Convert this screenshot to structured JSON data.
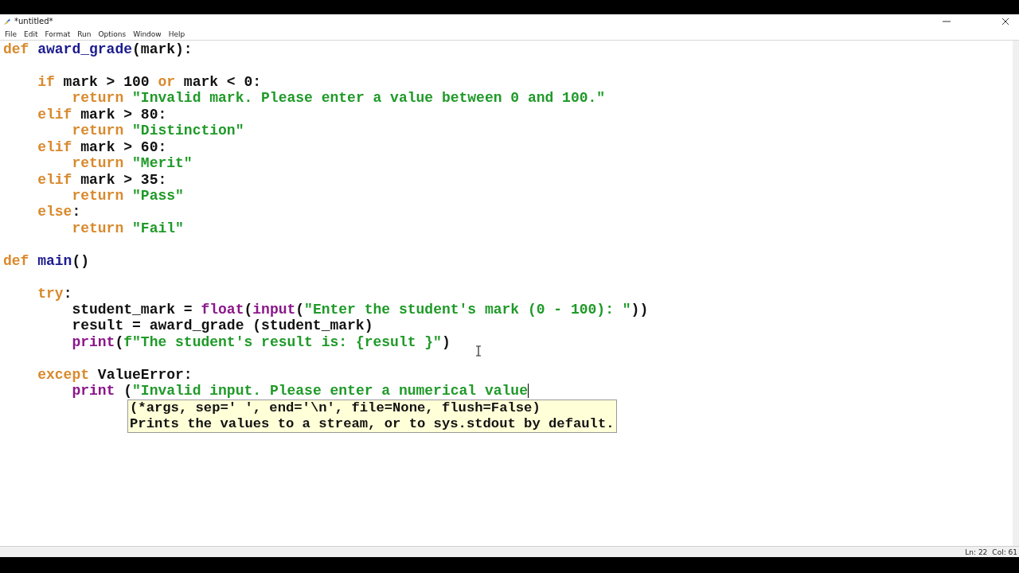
{
  "window": {
    "title": "*untitled*"
  },
  "menu": [
    "File",
    "Edit",
    "Format",
    "Run",
    "Options",
    "Window",
    "Help"
  ],
  "code_lines": [
    {
      "kind": "code",
      "caret": false,
      "tokens": [
        {
          "kind": "keyword",
          "text": "def"
        },
        {
          "kind": "definition",
          "text": " award_grade"
        },
        {
          "kind": "plain",
          "text": "(mark):"
        }
      ]
    },
    {
      "kind": "blank"
    },
    {
      "kind": "code",
      "caret": false,
      "tokens": [
        {
          "kind": "keyword",
          "text": "    if"
        },
        {
          "kind": "plain",
          "text": " mark > 100 "
        },
        {
          "kind": "keyword",
          "text": "or"
        },
        {
          "kind": "plain",
          "text": " mark < 0:"
        }
      ]
    },
    {
      "kind": "code",
      "caret": false,
      "tokens": [
        {
          "kind": "keyword",
          "text": "        return"
        },
        {
          "kind": "string",
          "text": " \"Invalid mark. Please enter a value between 0 and 100.\""
        }
      ]
    },
    {
      "kind": "code",
      "caret": false,
      "tokens": [
        {
          "kind": "keyword",
          "text": "    elif"
        },
        {
          "kind": "plain",
          "text": " mark > 80:"
        }
      ]
    },
    {
      "kind": "code",
      "caret": false,
      "tokens": [
        {
          "kind": "keyword",
          "text": "        return"
        },
        {
          "kind": "string",
          "text": " \"Distinction\""
        }
      ]
    },
    {
      "kind": "code",
      "caret": false,
      "tokens": [
        {
          "kind": "keyword",
          "text": "    elif"
        },
        {
          "kind": "plain",
          "text": " mark > 60:"
        }
      ]
    },
    {
      "kind": "code",
      "caret": false,
      "tokens": [
        {
          "kind": "keyword",
          "text": "        return"
        },
        {
          "kind": "string",
          "text": " \"Merit\""
        }
      ]
    },
    {
      "kind": "code",
      "caret": false,
      "tokens": [
        {
          "kind": "keyword",
          "text": "    elif"
        },
        {
          "kind": "plain",
          "text": " mark > 35:"
        }
      ]
    },
    {
      "kind": "code",
      "caret": false,
      "tokens": [
        {
          "kind": "keyword",
          "text": "        return"
        },
        {
          "kind": "string",
          "text": " \"Pass\""
        }
      ]
    },
    {
      "kind": "code",
      "caret": false,
      "tokens": [
        {
          "kind": "keyword",
          "text": "    else"
        },
        {
          "kind": "plain",
          "text": ":"
        }
      ]
    },
    {
      "kind": "code",
      "caret": false,
      "tokens": [
        {
          "kind": "keyword",
          "text": "        return"
        },
        {
          "kind": "string",
          "text": " \"Fail\""
        }
      ]
    },
    {
      "kind": "blank"
    },
    {
      "kind": "code",
      "caret": false,
      "tokens": [
        {
          "kind": "keyword",
          "text": "def"
        },
        {
          "kind": "definition",
          "text": " main"
        },
        {
          "kind": "plain",
          "text": "()"
        }
      ]
    },
    {
      "kind": "blank"
    },
    {
      "kind": "code",
      "caret": false,
      "tokens": [
        {
          "kind": "keyword",
          "text": "    try"
        },
        {
          "kind": "plain",
          "text": ":"
        }
      ]
    },
    {
      "kind": "code",
      "caret": false,
      "tokens": [
        {
          "kind": "plain",
          "text": "        student_mark = "
        },
        {
          "kind": "builtin",
          "text": "float"
        },
        {
          "kind": "plain",
          "text": "("
        },
        {
          "kind": "builtin",
          "text": "input"
        },
        {
          "kind": "plain",
          "text": "("
        },
        {
          "kind": "string",
          "text": "\"Enter the student's mark (0 - 100): \""
        },
        {
          "kind": "plain",
          "text": "))"
        }
      ]
    },
    {
      "kind": "code",
      "caret": false,
      "tokens": [
        {
          "kind": "plain",
          "text": "        result = award_grade (student_mark)"
        }
      ]
    },
    {
      "kind": "code",
      "caret": false,
      "tokens": [
        {
          "kind": "builtin",
          "text": "        print"
        },
        {
          "kind": "plain",
          "text": "("
        },
        {
          "kind": "string",
          "text": "f\"The student's result is: {result }\""
        },
        {
          "kind": "plain",
          "text": ")"
        }
      ]
    },
    {
      "kind": "blank"
    },
    {
      "kind": "code",
      "caret": false,
      "tokens": [
        {
          "kind": "keyword",
          "text": "    except"
        },
        {
          "kind": "plain",
          "text": " ValueError:"
        }
      ]
    },
    {
      "kind": "code",
      "caret": true,
      "tokens": [
        {
          "kind": "builtin",
          "text": "        print"
        },
        {
          "kind": "plain",
          "text": " ("
        },
        {
          "kind": "string",
          "text": "\"Invalid input. Please enter a numerical value"
        }
      ]
    }
  ],
  "calltip": {
    "signature": "(*args, sep=' ', end='\\n', file=None, flush=False)",
    "doc": "Prints the values to a stream, or to sys.stdout by default."
  },
  "status_bar": {
    "line": "Ln: 22",
    "column": "Col: 61"
  }
}
